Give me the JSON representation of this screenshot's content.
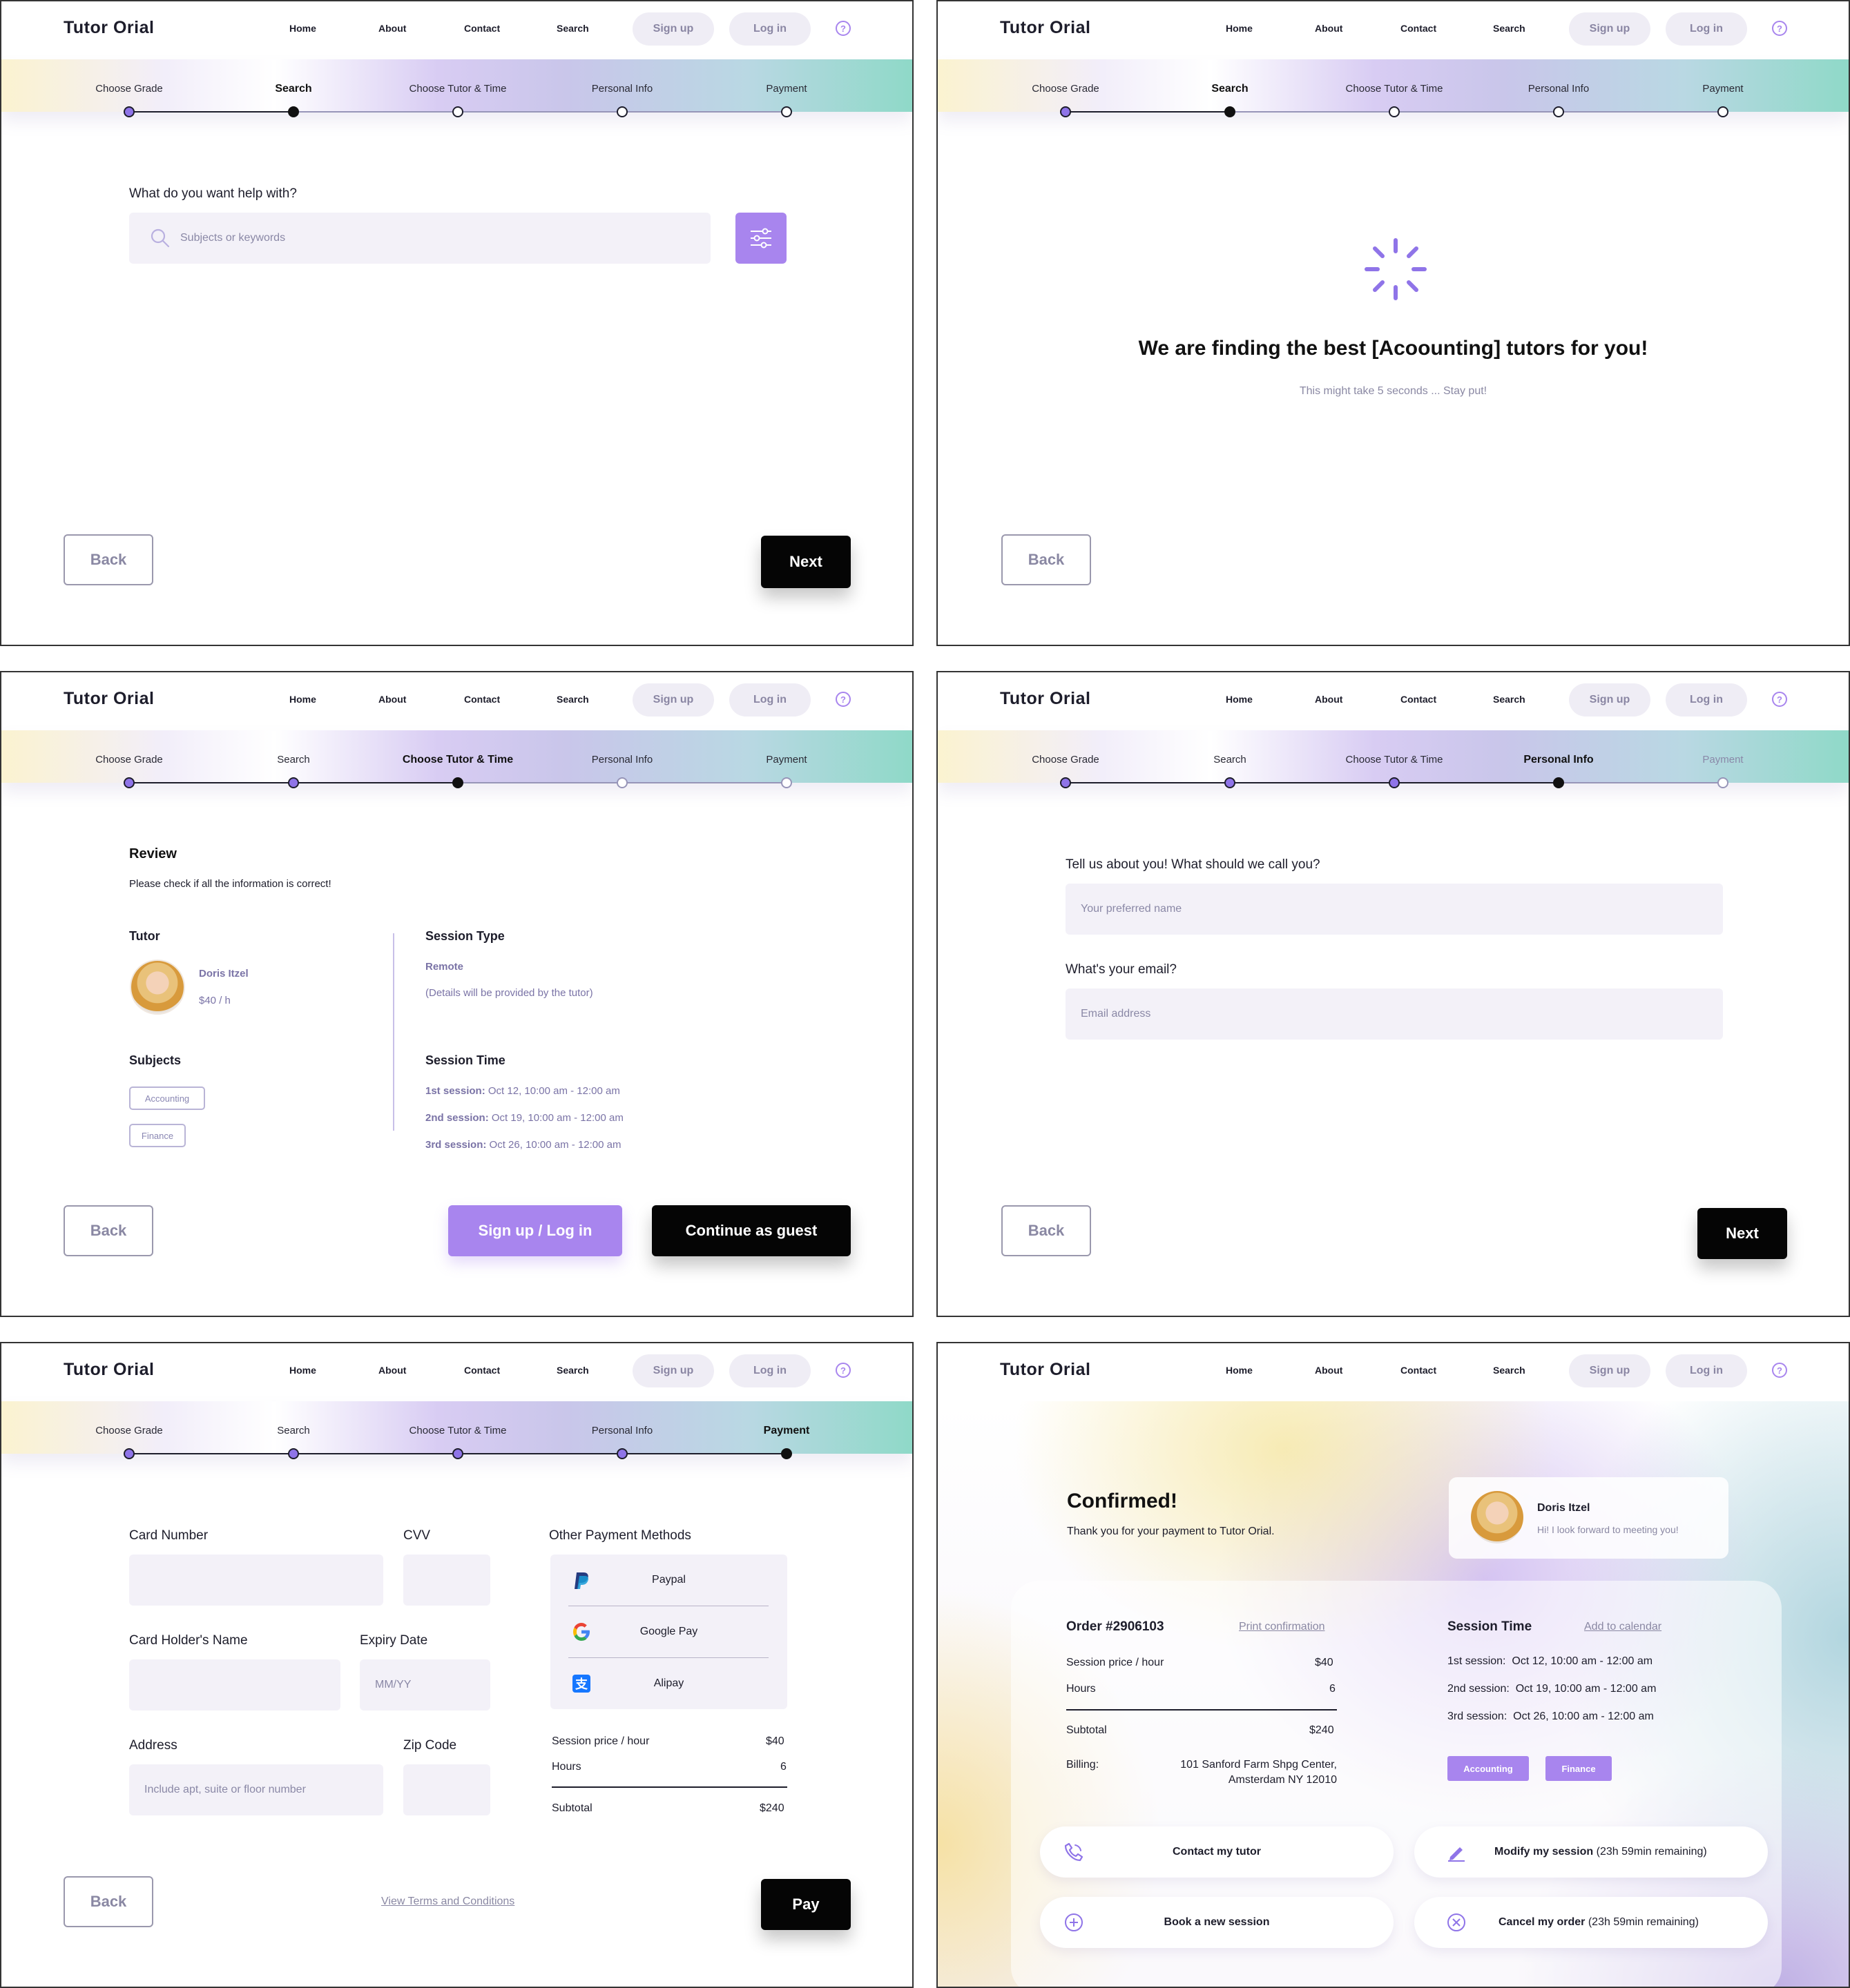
{
  "header": {
    "logo": "Tutor Orial",
    "nav": [
      "Home",
      "About",
      "Contact",
      "Search"
    ],
    "sign_up": "Sign up",
    "log_in": "Log in",
    "help": "?"
  },
  "steps": [
    "Choose Grade",
    "Search",
    "Choose Tutor & Time",
    "Personal Info",
    "Payment"
  ],
  "common": {
    "back": "Back",
    "next": "Next"
  },
  "search_screen": {
    "question": "What do you want help with?",
    "search_placeholder": "Subjects or keywords"
  },
  "loading_screen": {
    "title": "We are finding the best [Acoounting] tutors for you!",
    "subtitle": "This might take 5 seconds ... Stay put!"
  },
  "review_screen": {
    "title": "Review",
    "subtitle": "Please check if all the information is correct!",
    "tutor_heading": "Tutor",
    "tutor_name": "Doris Itzel",
    "tutor_rate": "$40 / h",
    "subjects_heading": "Subjects",
    "subjects": [
      "Accounting",
      "Finance"
    ],
    "session_type_heading": "Session Type",
    "session_type": "Remote",
    "session_type_note": "(Details will be provided by the tutor)",
    "session_time_heading": "Session Time",
    "sessions": [
      {
        "label": "1st session:",
        "value": "Oct 12, 10:00 am - 12:00 am"
      },
      {
        "label": "2nd session:",
        "value": "Oct 19, 10:00 am - 12:00 am"
      },
      {
        "label": "3rd session:",
        "value": "Oct 26, 10:00 am - 12:00 am"
      }
    ],
    "signup_login": "Sign up / Log in",
    "guest": "Continue as guest"
  },
  "personal_screen": {
    "name_question": "Tell us about you! What should we call you?",
    "name_placeholder": "Your preferred name",
    "email_question": "What's your email?",
    "email_placeholder": "Email address"
  },
  "payment_screen": {
    "card_number": "Card Number",
    "cvv": "CVV",
    "holder": "Card Holder's Name",
    "expiry": "Expiry Date",
    "expiry_placeholder": "MM/YY",
    "address": "Address",
    "address_placeholder": "Include apt, suite or floor number",
    "zip": "Zip Code",
    "other_methods": "Other Payment Methods",
    "methods": [
      "Paypal",
      "Google Pay",
      "Alipay"
    ],
    "price_label": "Session price / hour",
    "price_value": "$40",
    "hours_label": "Hours",
    "hours_value": "6",
    "subtotal_label": "Subtotal",
    "subtotal_value": "$240",
    "terms": "View Terms and Conditions",
    "pay": "Pay"
  },
  "confirm_screen": {
    "title": "Confirmed!",
    "subtitle": "Thank you for your payment to Tutor Orial.",
    "tutor_name": "Doris Itzel",
    "tutor_message": "Hi! I look forward to meeting you!",
    "order": "Order #2906103",
    "print": "Print confirmation",
    "price_label": "Session price / hour",
    "price_value": "$40",
    "hours_label": "Hours",
    "hours_value": "6",
    "subtotal_label": "Subtotal",
    "subtotal_value": "$240",
    "billing_label": "Billing:",
    "billing_line1": "101 Sanford Farm Shpg Center,",
    "billing_line2": "Amsterdam NY 12010",
    "session_time_heading": "Session Time",
    "add_calendar": "Add to calendar",
    "sessions": [
      "1st session:  Oct 12, 10:00 am - 12:00 am",
      "2nd session:  Oct 19, 10:00 am - 12:00 am",
      "3rd session:  Oct 26, 10:00 am - 12:00 am"
    ],
    "tags": [
      "Accounting",
      "Finance"
    ],
    "contact": "Contact my tutor",
    "modify": "Modify my session",
    "modify_note": "(23h 59min remaining)",
    "book": "Book a new session",
    "cancel": "Cancel my order",
    "cancel_note": "(23h 59min remaining)"
  },
  "colors": {
    "accent": "#a885ee",
    "dark": "#050505",
    "field": "#f3f1f8"
  }
}
